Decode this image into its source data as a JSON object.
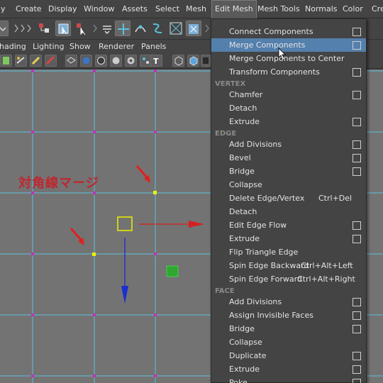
{
  "menubar": {
    "items": [
      "y",
      "Create",
      "Display",
      "Window",
      "Assets",
      "Select",
      "Mesh",
      "Edit Mesh",
      "Mesh Tools",
      "Normals",
      "Color",
      "Cre"
    ],
    "active": "Edit Mesh"
  },
  "panel_menu": {
    "items": [
      "hading",
      "Lighting",
      "Show",
      "Renderer",
      "Panels"
    ]
  },
  "viewport": {
    "annotation": "対角線マージ",
    "annotation_color": "#c0262d",
    "grid_color": "#5bc0de",
    "background": "#737373",
    "manipulator_x_color": "#d42020",
    "manipulator_y_color": "#1a2fd0",
    "manipulator_center_color": "#f0f000",
    "view_cube_color": "#2ea82e"
  },
  "dropdown": {
    "items": [
      {
        "label": "Connect Components",
        "option": true
      },
      {
        "label": "Merge Components",
        "option": true,
        "highlighted": true
      },
      {
        "label": "Merge Components to Center",
        "option": false
      },
      {
        "label": "Transform Components",
        "option": true
      },
      {
        "section": "VERTEX"
      },
      {
        "label": "Chamfer",
        "option": true
      },
      {
        "label": "Detach",
        "option": false
      },
      {
        "label": "Extrude",
        "option": true
      },
      {
        "section": "EDGE"
      },
      {
        "label": "Add Divisions",
        "option": true
      },
      {
        "label": "Bevel",
        "option": true
      },
      {
        "label": "Bridge",
        "option": true
      },
      {
        "label": "Collapse",
        "option": false
      },
      {
        "label": "Delete Edge/Vertex",
        "shortcut": "Ctrl+Del",
        "option": false
      },
      {
        "label": "Detach",
        "option": false
      },
      {
        "label": "Edit Edge Flow",
        "option": true
      },
      {
        "label": "Extrude",
        "option": true
      },
      {
        "label": "Flip Triangle Edge",
        "option": false
      },
      {
        "label": "Spin Edge Backward",
        "shortcut": "Ctrl+Alt+Left",
        "option": false
      },
      {
        "label": "Spin Edge Forward",
        "shortcut": "Ctrl+Alt+Right",
        "option": false
      },
      {
        "section": "FACE"
      },
      {
        "label": "Add Divisions",
        "option": true
      },
      {
        "label": "Assign Invisible Faces",
        "option": true
      },
      {
        "label": "Bridge",
        "option": true
      },
      {
        "label": "Collapse",
        "option": false
      },
      {
        "label": "Duplicate",
        "option": true
      },
      {
        "label": "Extrude",
        "option": true
      },
      {
        "label": "Poke",
        "option": true
      }
    ],
    "highlight_color": "#5480ad"
  }
}
